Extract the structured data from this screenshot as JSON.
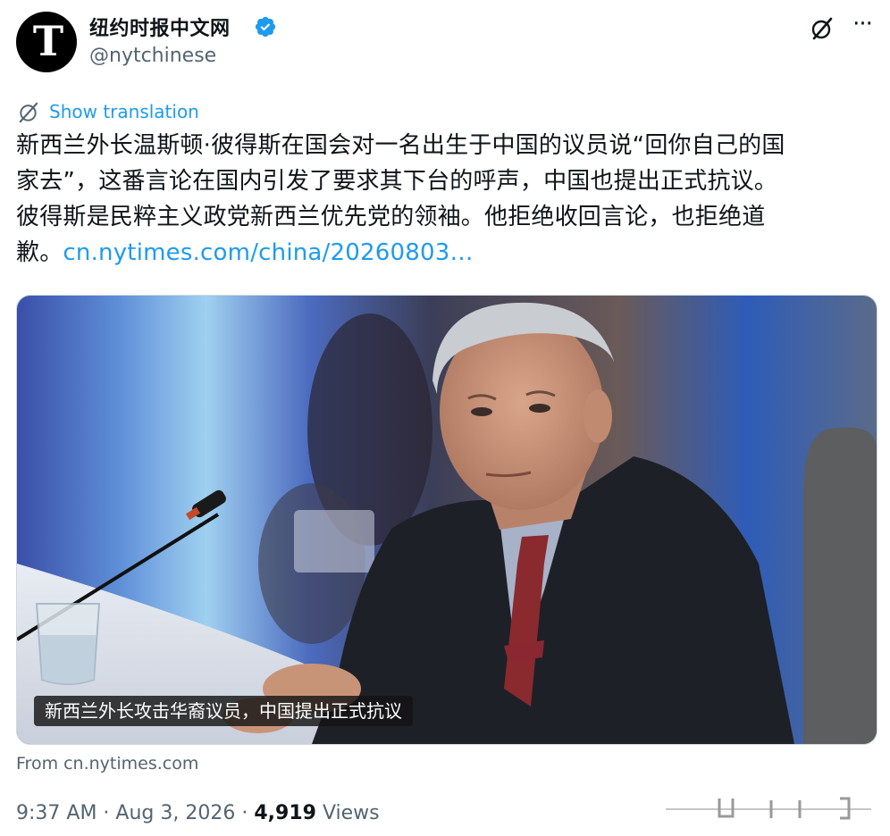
{
  "account": {
    "avatar_glyph": "T",
    "display_name": "纽约时报中文网",
    "handle": "@nytchinese",
    "verified_color": "#1d9bf0"
  },
  "actions": {
    "grok_icon": "grok-slash-circle-icon",
    "more_label": "···"
  },
  "translation": {
    "label": "Show translation"
  },
  "tweet": {
    "lines": [
      "新西兰外长温斯顿·彼得斯在国会对一名出生于中国的议员说“回你自己的国",
      "家去”，这番言论在国内引发了要求其下台的呼声，中国也提出正式抗议。",
      "彼得斯是民粹主义政党新西兰优先党的领袖。他拒绝收回言论，也拒绝道"
    ],
    "last_line_text": "歉。",
    "link_text": "cn.nytimes.com/china/20260803…",
    "link_color": "#1d9bf0"
  },
  "media": {
    "caption": "新西兰外长攻击华裔议员，中国提出正式抗议"
  },
  "source": {
    "label": "From cn.nytimes.com"
  },
  "meta": {
    "time": "9:37 AM",
    "separator": " · ",
    "date": "Aug 3, 2026",
    "views_count": "4,919",
    "views_label": "Views"
  },
  "colors": {
    "text_primary": "#0f1419",
    "text_secondary": "#536471",
    "accent": "#1d9bf0"
  }
}
